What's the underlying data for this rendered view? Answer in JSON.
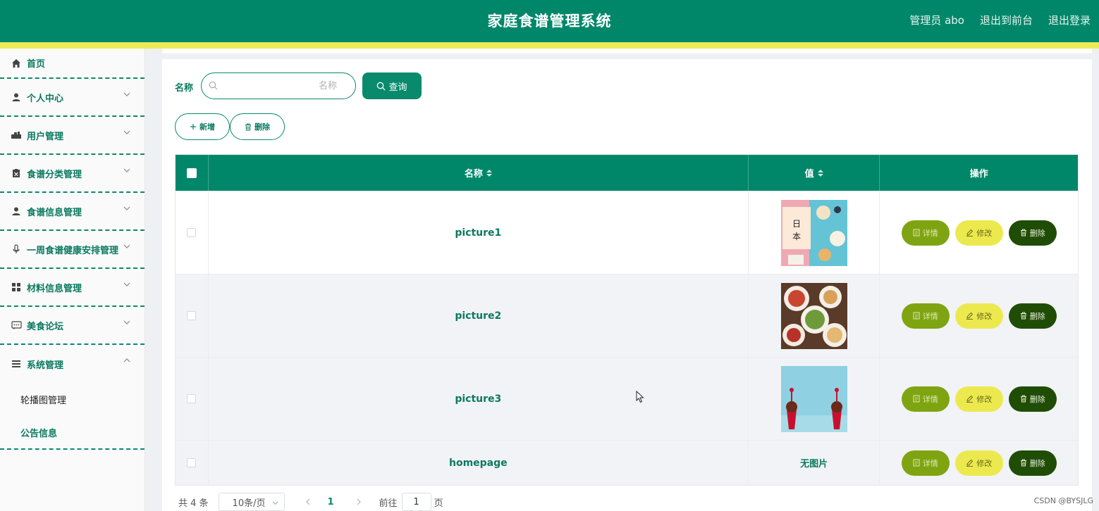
{
  "header": {
    "title": "家庭食谱管理系统",
    "links": [
      "管理员 abo",
      "退出到前台",
      "退出登录"
    ]
  },
  "sidebar": {
    "items": [
      {
        "label": "首页",
        "icon": "home-icon"
      },
      {
        "label": "个人中心",
        "icon": "user-icon"
      },
      {
        "label": "用户管理",
        "icon": "users-icon"
      },
      {
        "label": "食谱分类管理",
        "icon": "clipboard-icon"
      },
      {
        "label": "食谱信息管理",
        "icon": "user-icon"
      },
      {
        "label": "一周食谱健康安排管理",
        "icon": "microphone-icon"
      },
      {
        "label": "材料信息管理",
        "icon": "grid-icon"
      },
      {
        "label": "美食论坛",
        "icon": "chat-icon"
      },
      {
        "label": "系统管理",
        "icon": "list-icon"
      }
    ],
    "subitems": [
      "轮播图管理",
      "公告信息"
    ]
  },
  "search": {
    "label": "名称",
    "placeholder": "名称",
    "button": "查询"
  },
  "toolbar": {
    "add": "新增",
    "delete": "删除"
  },
  "table": {
    "headers": [
      "名称",
      "值",
      "操作"
    ],
    "rows": [
      {
        "name": "picture1",
        "image": "picture1"
      },
      {
        "name": "picture2",
        "image": "picture2"
      },
      {
        "name": "picture3",
        "image": "picture3"
      },
      {
        "name": "homepage",
        "value_text": "无图片"
      }
    ],
    "actions": {
      "detail": "详情",
      "edit": "修改",
      "delete": "删除"
    }
  },
  "pagination": {
    "total": "共 4 条",
    "page_size": "10条/页",
    "current_page": "1",
    "goto_label": "前往",
    "goto_value": "1",
    "goto_unit": "页"
  },
  "watermark": "CSDN @BYSJLG",
  "colors": {
    "primary": "#00876a",
    "stripe": "#ecea58",
    "detail": "#7ea511",
    "edit": "#ece94f",
    "delete": "#1f4d05"
  }
}
